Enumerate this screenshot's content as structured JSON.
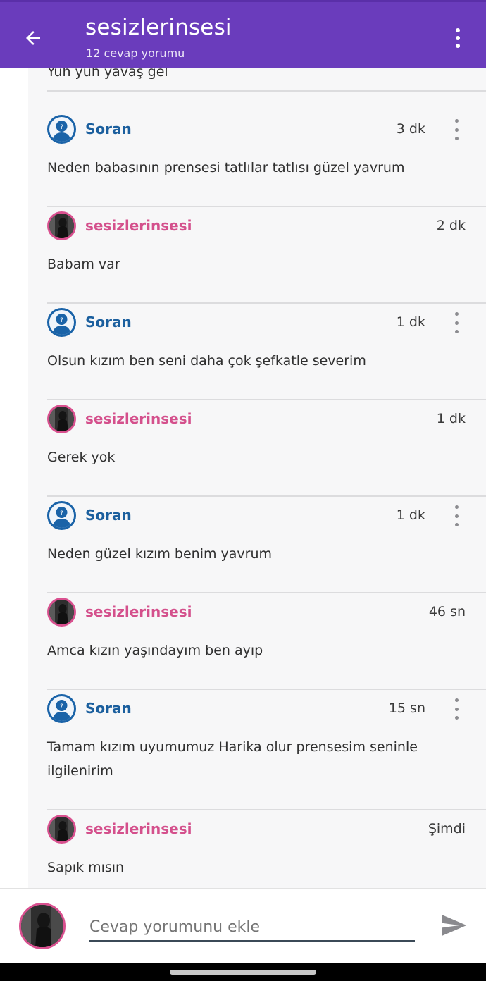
{
  "header": {
    "title": "sesizlerinsesi",
    "subtitle": "12 cevap yorumu",
    "back_icon": "arrow-left-icon",
    "menu_icon": "more-vertical-icon",
    "color": "#6a3cbc"
  },
  "thread": {
    "partial_top_text": "Yuh yuh yavaş gel",
    "comments": [
      {
        "user": "Soran",
        "type": "anon",
        "time": "3 dk",
        "text": "Neden babasının prensesi tatlılar tatlısı güzel yavrum"
      },
      {
        "user": "sesizlerinsesi",
        "type": "user",
        "time": "2 dk",
        "text": "Babam var"
      },
      {
        "user": "Soran",
        "type": "anon",
        "time": "1 dk",
        "text": "Olsun kızım ben seni daha çok şefkatle severim"
      },
      {
        "user": "sesizlerinsesi",
        "type": "user",
        "time": "1 dk",
        "text": "Gerek yok"
      },
      {
        "user": "Soran",
        "type": "anon",
        "time": "1 dk",
        "text": "Neden güzel kızım benim yavrum"
      },
      {
        "user": "sesizlerinsesi",
        "type": "user",
        "time": "46 sn",
        "text": "Amca kızın yaşındayım ben ayıp"
      },
      {
        "user": "Soran",
        "type": "anon",
        "time": "15 sn",
        "text": "Tamam kızım uyumumuz Harika olur prensesim seninle ilgilenirim"
      },
      {
        "user": "sesizlerinsesi",
        "type": "user",
        "time": "Şimdi",
        "text": "Sapık mısın"
      }
    ]
  },
  "composer": {
    "placeholder": "Cevap yorumunu ekle",
    "send_icon": "send-icon"
  },
  "colors": {
    "anon_name": "#1b5f9e",
    "user_name": "#d4508c",
    "panel_bg": "#f7f7f8"
  }
}
